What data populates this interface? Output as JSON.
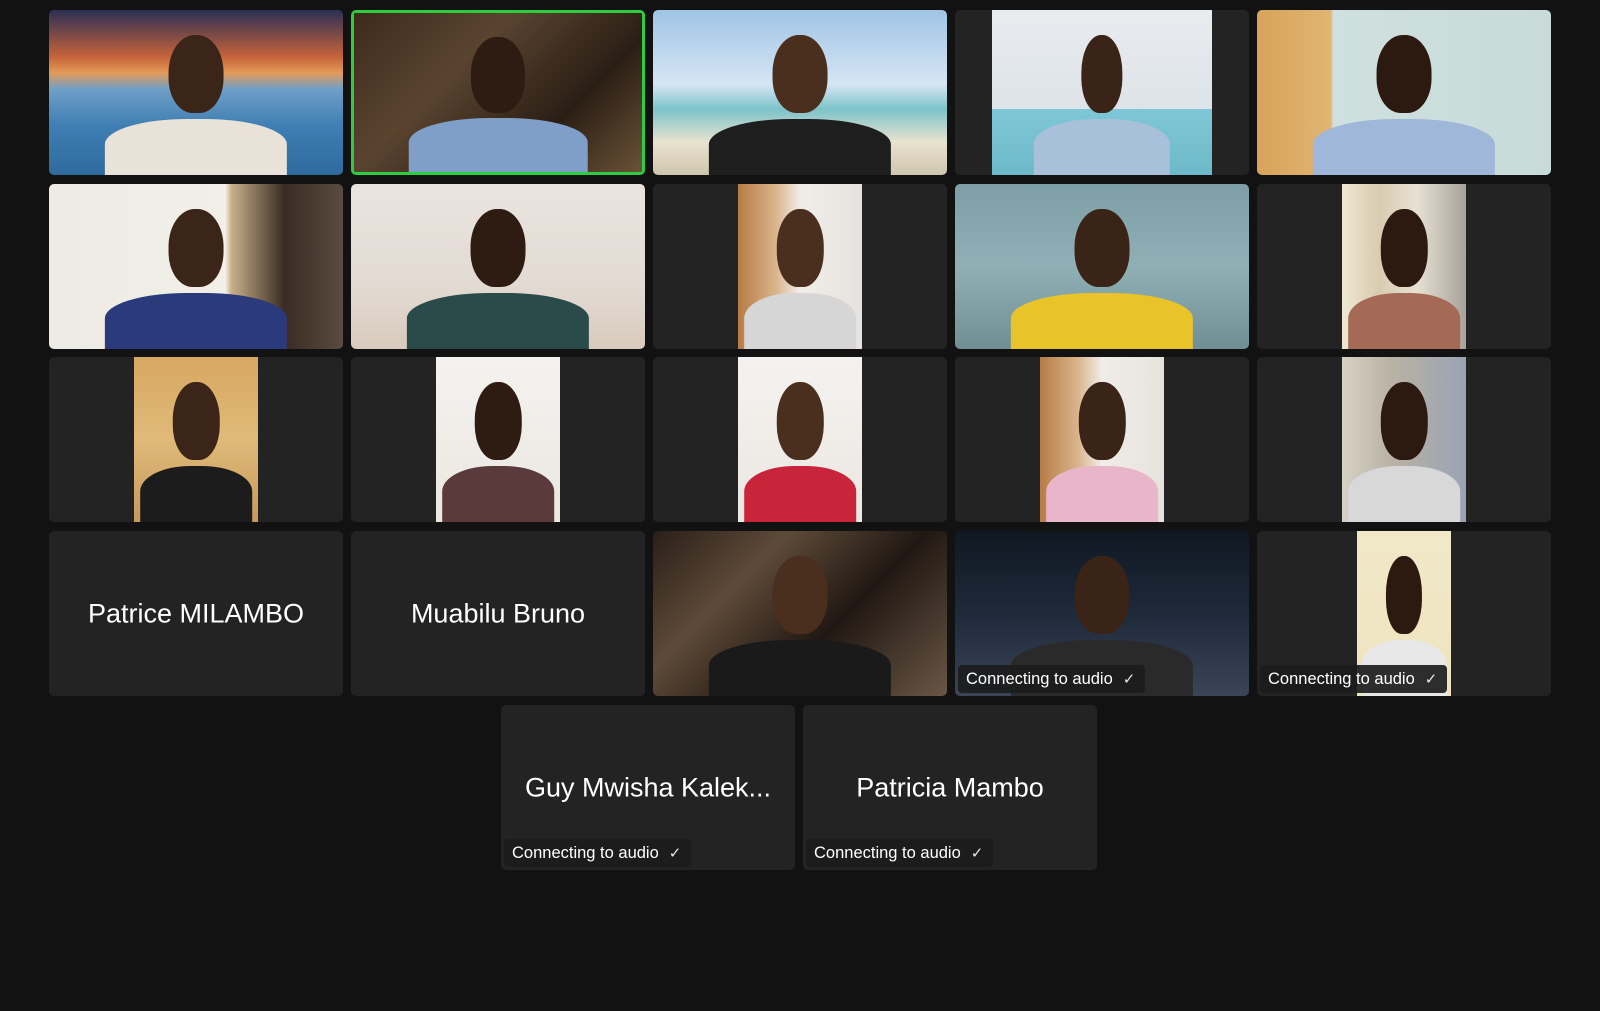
{
  "gallery": {
    "tiles": [
      {
        "id": "p1",
        "video": "full",
        "bg": "sunset-sea"
      },
      {
        "id": "p2",
        "video": "full",
        "bg": "office",
        "active": true
      },
      {
        "id": "p3",
        "video": "full",
        "bg": "beach"
      },
      {
        "id": "p4",
        "video": "mid",
        "bg": "room-light-blue"
      },
      {
        "id": "p5",
        "video": "full",
        "bg": "room-light"
      },
      {
        "id": "p6",
        "video": "full",
        "bg": "room-calendar"
      },
      {
        "id": "p7",
        "video": "full",
        "bg": "room-wall"
      },
      {
        "id": "p8",
        "video": "narrow",
        "bg": "room-shelf"
      },
      {
        "id": "p9",
        "video": "full",
        "bg": "room-grey"
      },
      {
        "id": "p10",
        "video": "narrow",
        "bg": "room-curtain"
      },
      {
        "id": "p11",
        "video": "narrow",
        "bg": "room-bookshelf"
      },
      {
        "id": "p12",
        "video": "narrow",
        "bg": "room-white"
      },
      {
        "id": "p13",
        "video": "narrow",
        "bg": "room-white"
      },
      {
        "id": "p14",
        "video": "narrow",
        "bg": "room-shelf"
      },
      {
        "id": "p15",
        "video": "narrow",
        "bg": "room-curtain-dark"
      },
      {
        "id": "p16",
        "video": "none",
        "name": "Patrice MILAMBO"
      },
      {
        "id": "p17",
        "video": "none",
        "name": "Muabilu Bruno"
      },
      {
        "id": "p18",
        "video": "full",
        "bg": "room-dark"
      },
      {
        "id": "p19",
        "video": "full",
        "bg": "night-street",
        "status": "Connecting to audio"
      },
      {
        "id": "p20",
        "video": "narrow2",
        "bg": "room-pale",
        "status": "Connecting to audio"
      },
      {
        "id": "p21",
        "video": "none",
        "name": "Guy Mwisha Kalek...",
        "status": "Connecting to audio"
      },
      {
        "id": "p22",
        "video": "none",
        "name": "Patricia Mambo",
        "status": "Connecting to audio"
      }
    ]
  },
  "icons": {
    "check": "check-icon"
  },
  "colors": {
    "background": "#121212",
    "tile": "#232323",
    "active_speaker_border": "#2ecc40"
  }
}
